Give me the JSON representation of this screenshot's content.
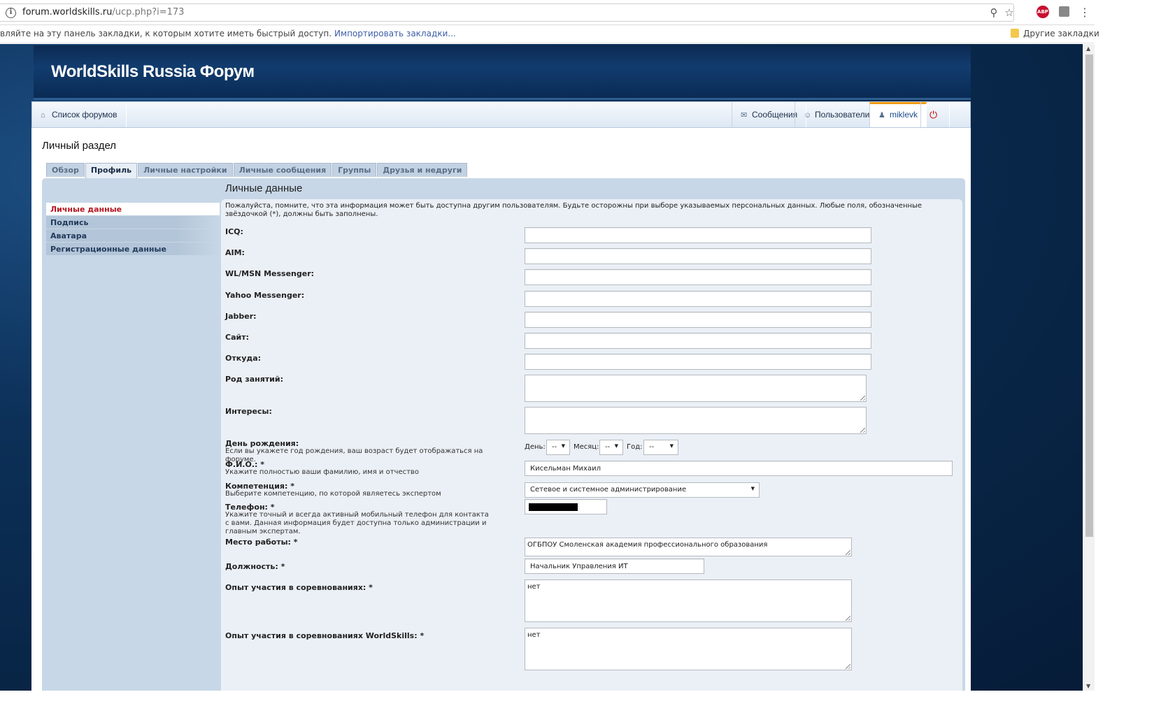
{
  "browser": {
    "url_host": "forum.worldskills.ru",
    "url_path": "/ucp.php?i=173",
    "bookmarks_hint": "вляйте на эту панель закладки, к которым хотите иметь быстрый доступ.",
    "bookmarks_import": "Импортировать закладки...",
    "other_bookmarks": "Другие закладки"
  },
  "site": {
    "title": "WorldSkills Russia Форум"
  },
  "nav": {
    "home": "Список форумов",
    "messages": "Сообщения",
    "users": "Пользователи",
    "username": "miklevk"
  },
  "page": {
    "title": "Личный раздел",
    "tabs": [
      "Обзор",
      "Профиль",
      "Личные настройки",
      "Личные сообщения",
      "Группы",
      "Друзья и недруги"
    ],
    "active_tab": "Профиль"
  },
  "side_menu": [
    "Личные данные",
    "Подпись",
    "Аватара",
    "Регистрационные данные"
  ],
  "form": {
    "section_title": "Личные данные",
    "intro": "Пожалуйста, помните, что эта информация может быть доступна другим пользователям. Будьте осторожны при выборе указываемых персональных данных. Любые поля, обозначенные звёздочкой (*), должны быть заполнены.",
    "icq_label": "ICQ:",
    "aim_label": "AIM:",
    "msn_label": "WL/MSN Messenger:",
    "yahoo_label": "Yahoo Messenger:",
    "jabber_label": "Jabber:",
    "site_label": "Сайт:",
    "from_label": "Откуда:",
    "occupation_label": "Род занятий:",
    "interests_label": "Интересы:",
    "birthday_label": "День рождения:",
    "birthday_hint": "Если вы укажете год рождения, ваш возраст будет отображаться на форуме.",
    "day_label": "День:",
    "month_label": "Месяц:",
    "year_label": "Год:",
    "day_value": "--",
    "month_value": "--",
    "year_value": "--",
    "fio_label": "Ф.И.О.: *",
    "fio_hint": "Укажите полностью ваши фамилию, имя и отчество",
    "fio_value": "Кисельман Михаил",
    "competence_label": "Компетенция: *",
    "competence_hint": "Выберите компетенцию, по которой являетесь экспертом",
    "competence_value": "Сетевое и системное администрирование",
    "phone_label": "Телефон: *",
    "phone_hint": "Укажите точный и всегда активный мобильный телефон для контакта с вами. Данная информация будет доступна только администрации и главным экспертам.",
    "workplace_label": "Место работы: *",
    "workplace_value": "ОГБПОУ Смоленская академия профессионального образования",
    "position_label": "Должность: *",
    "position_value": "Начальник Управления ИТ",
    "experience_label": "Опыт участия в соревнованиях: *",
    "experience_value": "нет",
    "ws_experience_label": "Опыт участия в соревнованиях WorldSkills: *",
    "ws_experience_value": "нет"
  }
}
